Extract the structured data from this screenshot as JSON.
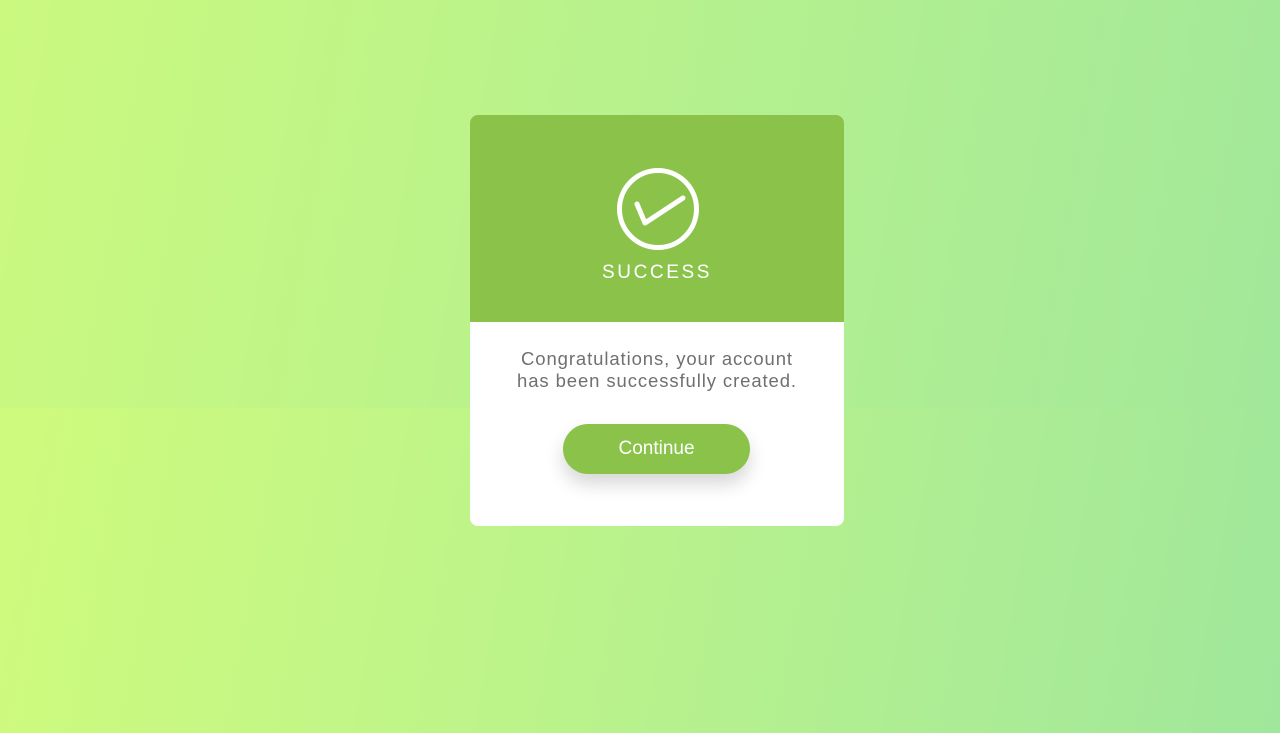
{
  "dialog": {
    "title": "SUCCESS",
    "icon": "check-circle-icon",
    "message_line1": "Congratulations, your account",
    "message_line2": "has been successfully created.",
    "button_label": "Continue"
  },
  "colors": {
    "accent": "#8bc34a",
    "card_background": "#ffffff",
    "message_text": "#707070",
    "background_start": "#cbf97f",
    "background_end": "#a2e89a"
  }
}
